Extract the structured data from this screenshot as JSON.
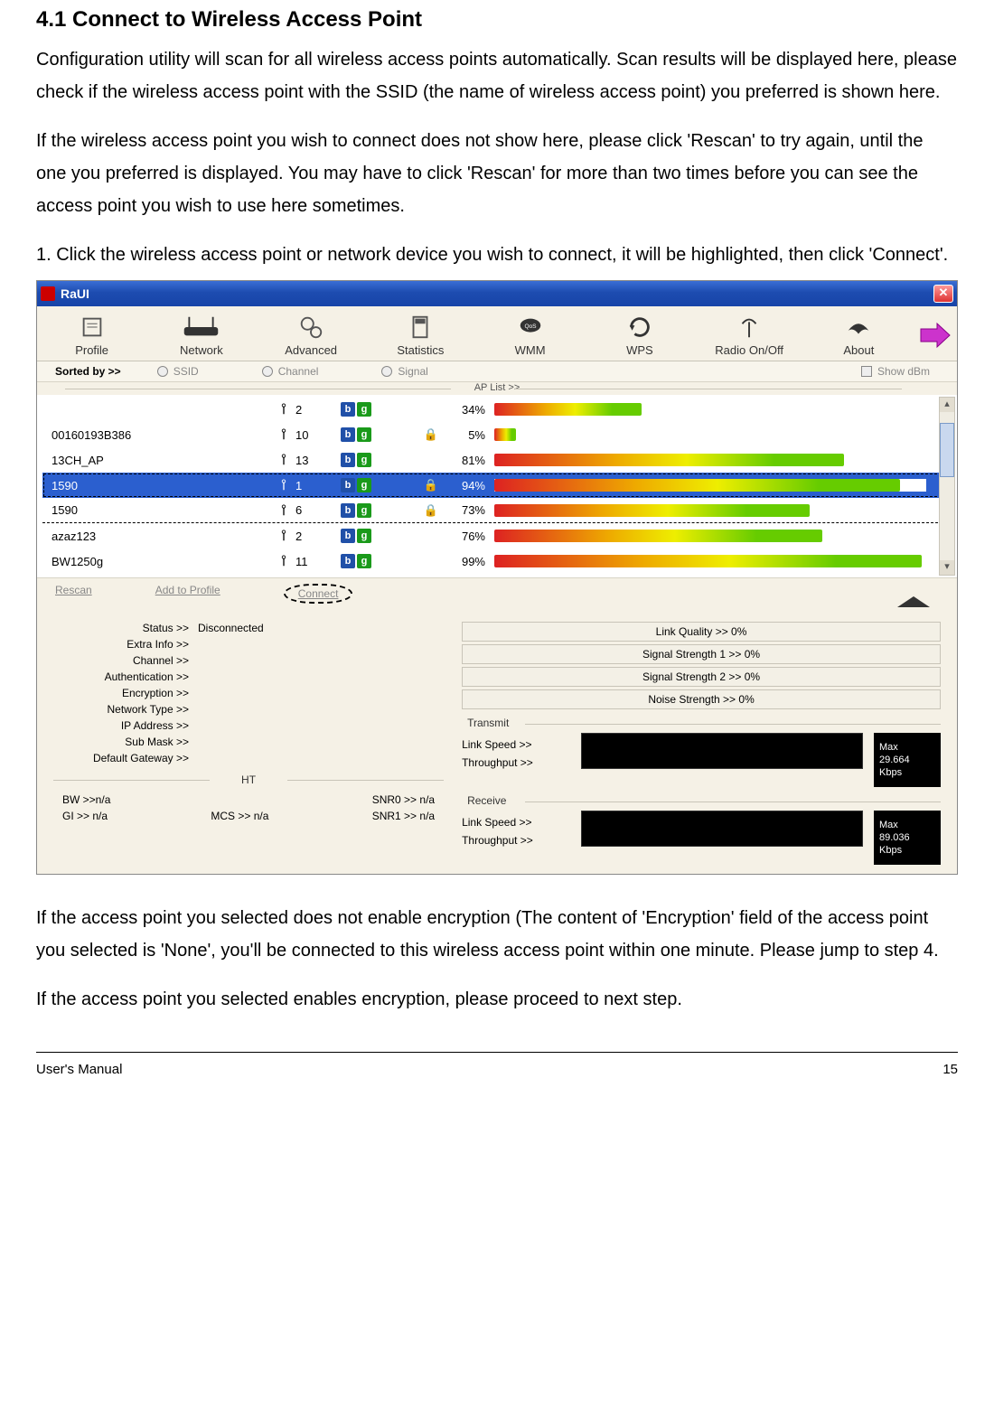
{
  "doc": {
    "section_title": "4.1 Connect to Wireless Access Point",
    "para1": "Configuration utility will scan for all wireless access points automatically. Scan results will be displayed here, please check if the wireless access point with the SSID (the name of wireless access point) you preferred is shown here.",
    "para2": "If the wireless access point you wish to connect does not show here, please click 'Rescan' to try again, until the one you preferred is displayed. You may have to click 'Rescan' for more than two times before you can see the access point you wish to use here sometimes.",
    "step1": "1.      Click the wireless access point or network device you wish to connect, it will be highlighted, then click 'Connect'.",
    "para3": "If the access point you selected does not enable encryption (The content of 'Encryption' field of the access point you selected is 'None', you'll be connected to this wireless access point within one minute. Please jump to step 4.",
    "para4": "If the access point you selected enables encryption, please proceed to next step.",
    "footer_left": "User's Manual",
    "page_number": "15"
  },
  "app": {
    "title": "RaUI",
    "tabs": [
      "Profile",
      "Network",
      "Advanced",
      "Statistics",
      "WMM",
      "WPS",
      "Radio On/Off",
      "About"
    ],
    "sort_label": "Sorted by >>",
    "sort_opts": [
      "SSID",
      "Channel",
      "Signal"
    ],
    "show_dbm": "Show dBm",
    "ap_list_label": "AP List >>",
    "actions": {
      "rescan": "Rescan",
      "add": "Add to Profile",
      "connect": "Connect"
    },
    "ap_rows": [
      {
        "ssid": "",
        "ch": "2",
        "lock": false,
        "sig": "34%",
        "bar": 34,
        "sel": false,
        "dash": false
      },
      {
        "ssid": "00160193B386",
        "ch": "10",
        "lock": true,
        "sig": "5%",
        "bar": 5,
        "sel": false,
        "dash": false
      },
      {
        "ssid": "13CH_AP",
        "ch": "13",
        "lock": false,
        "sig": "81%",
        "bar": 81,
        "sel": false,
        "dash": false
      },
      {
        "ssid": "1590",
        "ch": "1",
        "lock": true,
        "sig": "94%",
        "bar": 94,
        "sel": true,
        "dash": false
      },
      {
        "ssid": "1590",
        "ch": "6",
        "lock": true,
        "sig": "73%",
        "bar": 73,
        "sel": false,
        "dash": true
      },
      {
        "ssid": "azaz123",
        "ch": "2",
        "lock": false,
        "sig": "76%",
        "bar": 76,
        "sel": false,
        "dash": false
      },
      {
        "ssid": "BW1250g",
        "ch": "11",
        "lock": false,
        "sig": "99%",
        "bar": 99,
        "sel": false,
        "dash": false
      }
    ],
    "status": {
      "labels": {
        "status": "Status >>",
        "extra": "Extra Info >>",
        "channel": "Channel >>",
        "auth": "Authentication >>",
        "enc": "Encryption >>",
        "ntype": "Network Type >>",
        "ip": "IP Address >>",
        "mask": "Sub Mask >>",
        "gw": "Default Gateway >>"
      },
      "values": {
        "status": "Disconnected"
      },
      "meters": {
        "link_quality": "Link Quality >> 0%",
        "sig1": "Signal Strength 1 >> 0%",
        "sig2": "Signal Strength 2 >> 0%",
        "noise": "Noise Strength >> 0%"
      },
      "ht_title": "HT",
      "ht": {
        "bw": "BW >>n/a",
        "snr0": "SNR0 >>  n/a",
        "gi": "GI >> n/a",
        "mcs": "MCS >>   n/a",
        "snr1": "SNR1 >> n/a"
      },
      "transmit": {
        "title": "Transmit",
        "linkspeed": "Link Speed >>",
        "throughput": "Throughput >>"
      },
      "receive": {
        "title": "Receive",
        "linkspeed": "Link Speed >>",
        "throughput": "Throughput >>"
      },
      "box_tx": {
        "max": "Max",
        "val": "29.664",
        "unit": "Kbps"
      },
      "box_rx": {
        "max": "Max",
        "val": "89.036",
        "unit": "Kbps"
      }
    }
  }
}
